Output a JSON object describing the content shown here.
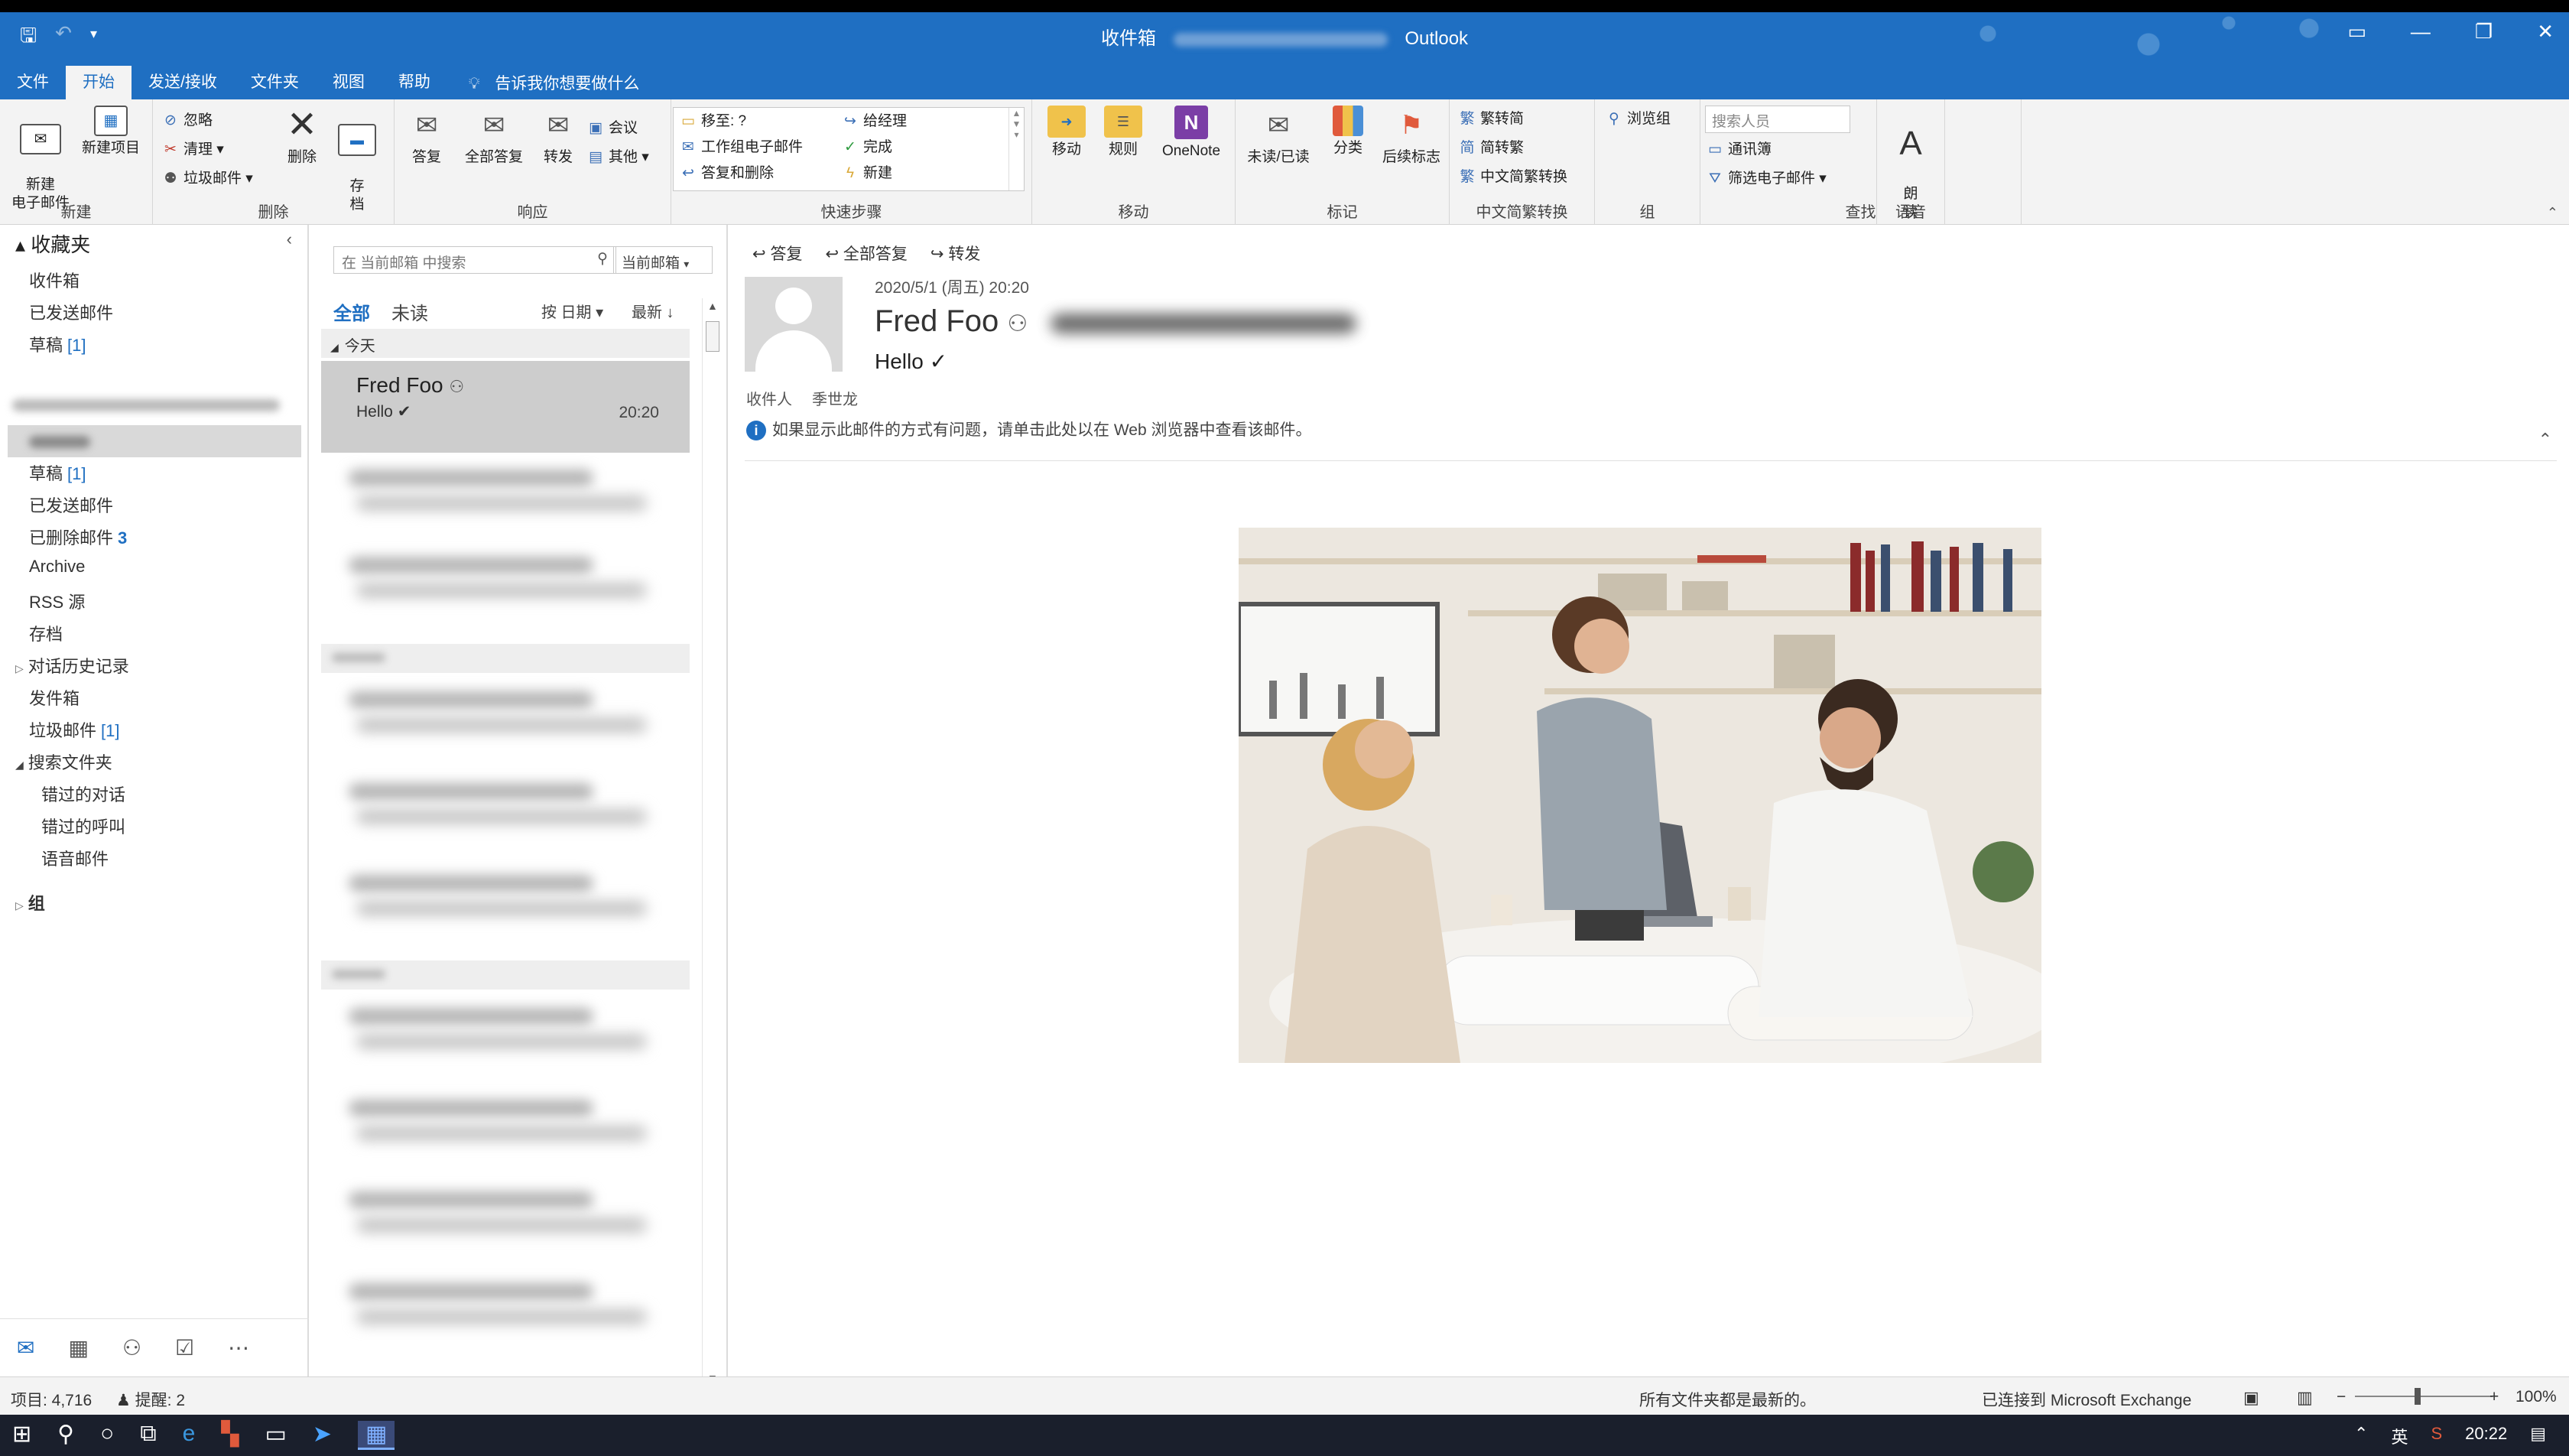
{
  "window": {
    "title_left": "收件箱",
    "app_name": "Outlook"
  },
  "quick_access": [
    "save-icon",
    "undo-icon",
    "customize-icon"
  ],
  "menu_tabs": [
    "文件",
    "开始",
    "发送/接收",
    "文件夹",
    "视图",
    "帮助"
  ],
  "active_tab": "开始",
  "tell_me": "告诉我你想要做什么",
  "ribbon": {
    "new": {
      "new_email": "新建\n电子邮件",
      "new_items": "新建项目",
      "label": "新建"
    },
    "delete": {
      "ignore": "忽略",
      "cleanup": "清理 ▾",
      "junk": "垃圾邮件 ▾",
      "delete": "删除",
      "archive": "存\n档",
      "label": "删除"
    },
    "respond": {
      "reply": "答复",
      "reply_all": "全部答复",
      "forward": "转发",
      "meeting": "会议",
      "more": "其他 ▾",
      "label": "响应"
    },
    "quick_steps": {
      "move_to": "移至: ?",
      "team_email": "工作组电子邮件",
      "reply_delete": "答复和删除",
      "to_manager": "给经理",
      "done": "完成",
      "create_new": "新建",
      "label": "快速步骤"
    },
    "move": {
      "move": "移动",
      "rules": "规则",
      "onenote": "OneNote",
      "label": "移动"
    },
    "tags": {
      "unread_read": "未读/已读",
      "categorize": "分类",
      "follow_up": "后续标志",
      "label": "标记"
    },
    "chinese_conv": {
      "to_traditional": "繁转简",
      "to_simplified": "简转繁",
      "conversion": "中文简繁转换",
      "label": "中文简繁转换"
    },
    "groups": {
      "browse": "浏览组",
      "label": "组"
    },
    "find": {
      "search_people": "搜索人员",
      "address_book": "通讯簿",
      "filter_email": "筛选电子邮件 ▾",
      "label": "查找"
    },
    "speech": {
      "read_aloud": "朗\n读",
      "label": "语音"
    }
  },
  "nav": {
    "favorites_header": "收藏夹",
    "favorites": [
      {
        "label": "收件箱",
        "count": ""
      },
      {
        "label": "已发送邮件",
        "count": ""
      },
      {
        "label": "草稿",
        "count": "[1]"
      }
    ],
    "folders": [
      {
        "label": "草稿",
        "count": "[1]"
      },
      {
        "label": "已发送邮件",
        "count": ""
      },
      {
        "label": "已删除邮件",
        "count": "3"
      },
      {
        "label": "Archive",
        "count": ""
      },
      {
        "label": "RSS 源",
        "count": ""
      },
      {
        "label": "存档",
        "count": ""
      },
      {
        "label": "对话历史记录",
        "count": ""
      },
      {
        "label": "发件箱",
        "count": ""
      },
      {
        "label": "垃圾邮件",
        "count": "[1]"
      },
      {
        "label": "搜索文件夹",
        "count": ""
      }
    ],
    "search_subfolders": [
      "错过的对话",
      "错过的呼叫",
      "语音邮件"
    ],
    "groups_header": "组"
  },
  "list": {
    "search_placeholder": "在 当前邮箱 中搜索",
    "scope": "当前邮箱",
    "filter_all": "全部",
    "filter_unread": "未读",
    "sort_by": "按 日期 ▾",
    "sort_order": "最新 ↓",
    "group_today": "今天",
    "selected": {
      "from": "Fred Foo",
      "subject": "Hello ✔",
      "time": "20:20"
    }
  },
  "reading": {
    "toolbar": {
      "reply": "答复",
      "reply_all": "全部答复",
      "forward": "转发"
    },
    "date": "2020/5/1 (周五) 20:20",
    "from": "Fred Foo",
    "subject": "Hello ✓",
    "to_label": "收件人",
    "to": "季世龙",
    "info": "如果显示此邮件的方式有问题，请单击此处以在 Web 浏览器中查看该邮件。"
  },
  "status": {
    "items": "项目: 4,716",
    "reminders": "提醒: 2",
    "sync": "所有文件夹都是最新的。",
    "connection": "已连接到 Microsoft Exchange",
    "zoom": "100%"
  },
  "taskbar": {
    "ime": "英",
    "clock": "20:22"
  },
  "colors": {
    "accent": "#1f6fc2",
    "ribbon_bg": "#f3f3f3",
    "taskbar_bg": "#1a1f2c"
  }
}
